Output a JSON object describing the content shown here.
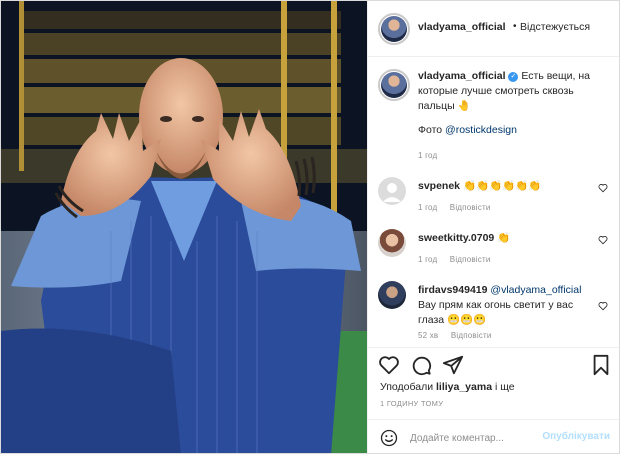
{
  "post": {
    "author": "vladyama_official",
    "follow_dot": "•",
    "follow_label": "Відстежується"
  },
  "caption": {
    "author": "vladyama_official",
    "text": "Есть вещи, на которые лучше смотреть сквозь пальцы",
    "emoji": "🤚",
    "photo_prefix": "Фото ",
    "photo_credit": "@rostickdesign",
    "time": "1 год"
  },
  "comments": [
    {
      "author": "svpenek",
      "text": "👏👏👏👏👏👏",
      "time": "1 год",
      "reply": "Відповісти"
    },
    {
      "author": "sweetkitty.0709",
      "text": "👏",
      "time": "1 год",
      "reply": "Відповісти"
    },
    {
      "author": "firdavs949419",
      "mention": "@vladyama_official",
      "text": "Вау прям как огонь светит у вас глаза",
      "emoji": "😬😬😬",
      "time": "52 хв",
      "reply": "Відповісти"
    }
  ],
  "likes": {
    "prefix": "Уподобали ",
    "user": "liliya_yama",
    "suffix": " і ще"
  },
  "timestamp": "1 ГОДИНУ ТОМУ",
  "comment_box": {
    "placeholder": "Додайте коментар...",
    "post_label": "Опублікувати"
  },
  "icons": [
    "like-heart-icon",
    "comment-bubble-icon",
    "share-paper-plane-icon",
    "save-bookmark-icon",
    "emoji-smile-icon",
    "verified-badge-icon",
    "comment-like-heart-icon"
  ],
  "colors": {
    "link": "#00376b",
    "verified": "#3897f0",
    "muted": "#8e8e8e",
    "post_disabled": "#b2dffc",
    "suit": "#2c4ea0"
  }
}
